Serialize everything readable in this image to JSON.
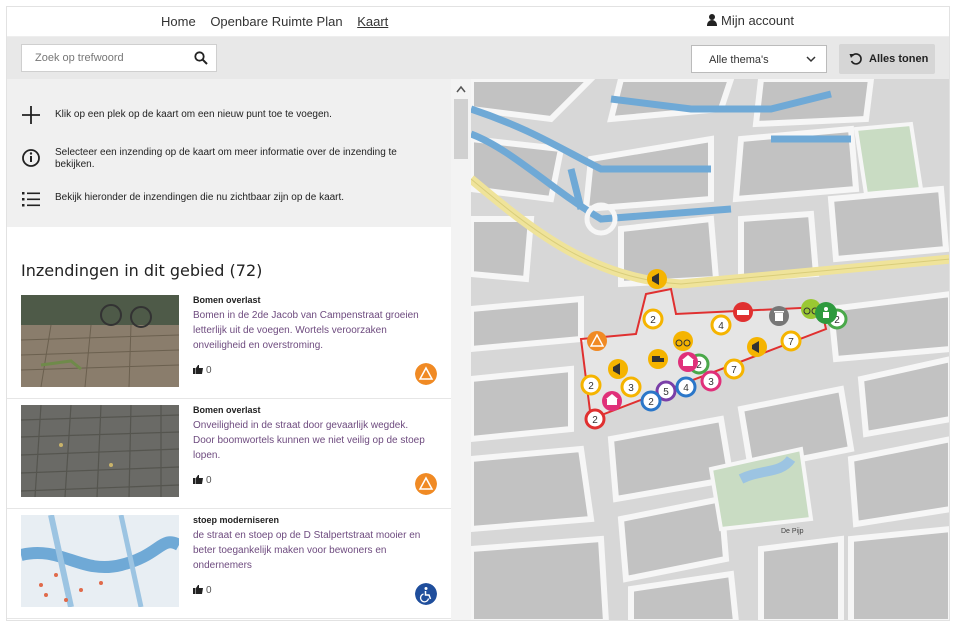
{
  "nav": {
    "home": "Home",
    "plan": "Openbare Ruimte Plan",
    "map": "Kaart",
    "account": "Mijn account"
  },
  "toolbar": {
    "search_placeholder": "Zoek op trefwoord",
    "theme_select": "Alle thema's",
    "reset_label": "Alles tonen"
  },
  "info": {
    "add_text": "Klik op een plek op de kaart om een nieuw punt toe te voegen.",
    "select_text": "Selecteer een inzending op de kaart om meer informatie over de inzending te bekijken.",
    "list_text": "Bekijk hieronder de inzendingen die nu zichtbaar zijn op de kaart."
  },
  "list": {
    "title": "Inzendingen in dit gebied (72)",
    "items": [
      {
        "title": "Bomen overlast",
        "description": "Bomen in de 2de Jacob van Campenstraat groeien letterlijk uit de voegen. Wortels veroorzaken onveiligheid en overstroming.",
        "likes": "0",
        "badge_color": "#f08a24",
        "badge_icon": "warning-icon"
      },
      {
        "title": "Bomen overlast",
        "description": "Onveiligheid in de straat door gevaarlijk wegdek. Door boomwortels kunnen we niet veilig op de stoep lopen.",
        "likes": "0",
        "badge_color": "#f08a24",
        "badge_icon": "warning-icon"
      },
      {
        "title": "stoep moderniseren",
        "description": "de straat en stoep op de D Stalpertstraat mooier en beter toegankelijk maken voor bewoners en ondernemers",
        "likes": "0",
        "badge_color": "#1f4e9c",
        "badge_icon": "wheelchair-icon"
      }
    ]
  },
  "map": {
    "area_label": "De Pijp",
    "colors": {
      "water": "#6fa9d6",
      "road_main": "#f3e9a8",
      "park": "#c9dcc3",
      "area_outline": "#e03030"
    },
    "markers": [
      {
        "label": "2",
        "type": "number"
      },
      {
        "label": "4",
        "type": "number"
      },
      {
        "label": "7",
        "type": "number"
      },
      {
        "label": "2",
        "type": "number"
      },
      {
        "label": "2",
        "type": "number"
      },
      {
        "label": "3",
        "type": "number"
      },
      {
        "label": "5",
        "type": "number"
      },
      {
        "label": "4",
        "type": "number"
      },
      {
        "label": "3",
        "type": "number"
      },
      {
        "label": "7",
        "type": "number"
      },
      {
        "label": "2",
        "type": "number"
      },
      {
        "label": "2",
        "type": "number"
      },
      {
        "label": "2",
        "type": "number"
      }
    ]
  }
}
